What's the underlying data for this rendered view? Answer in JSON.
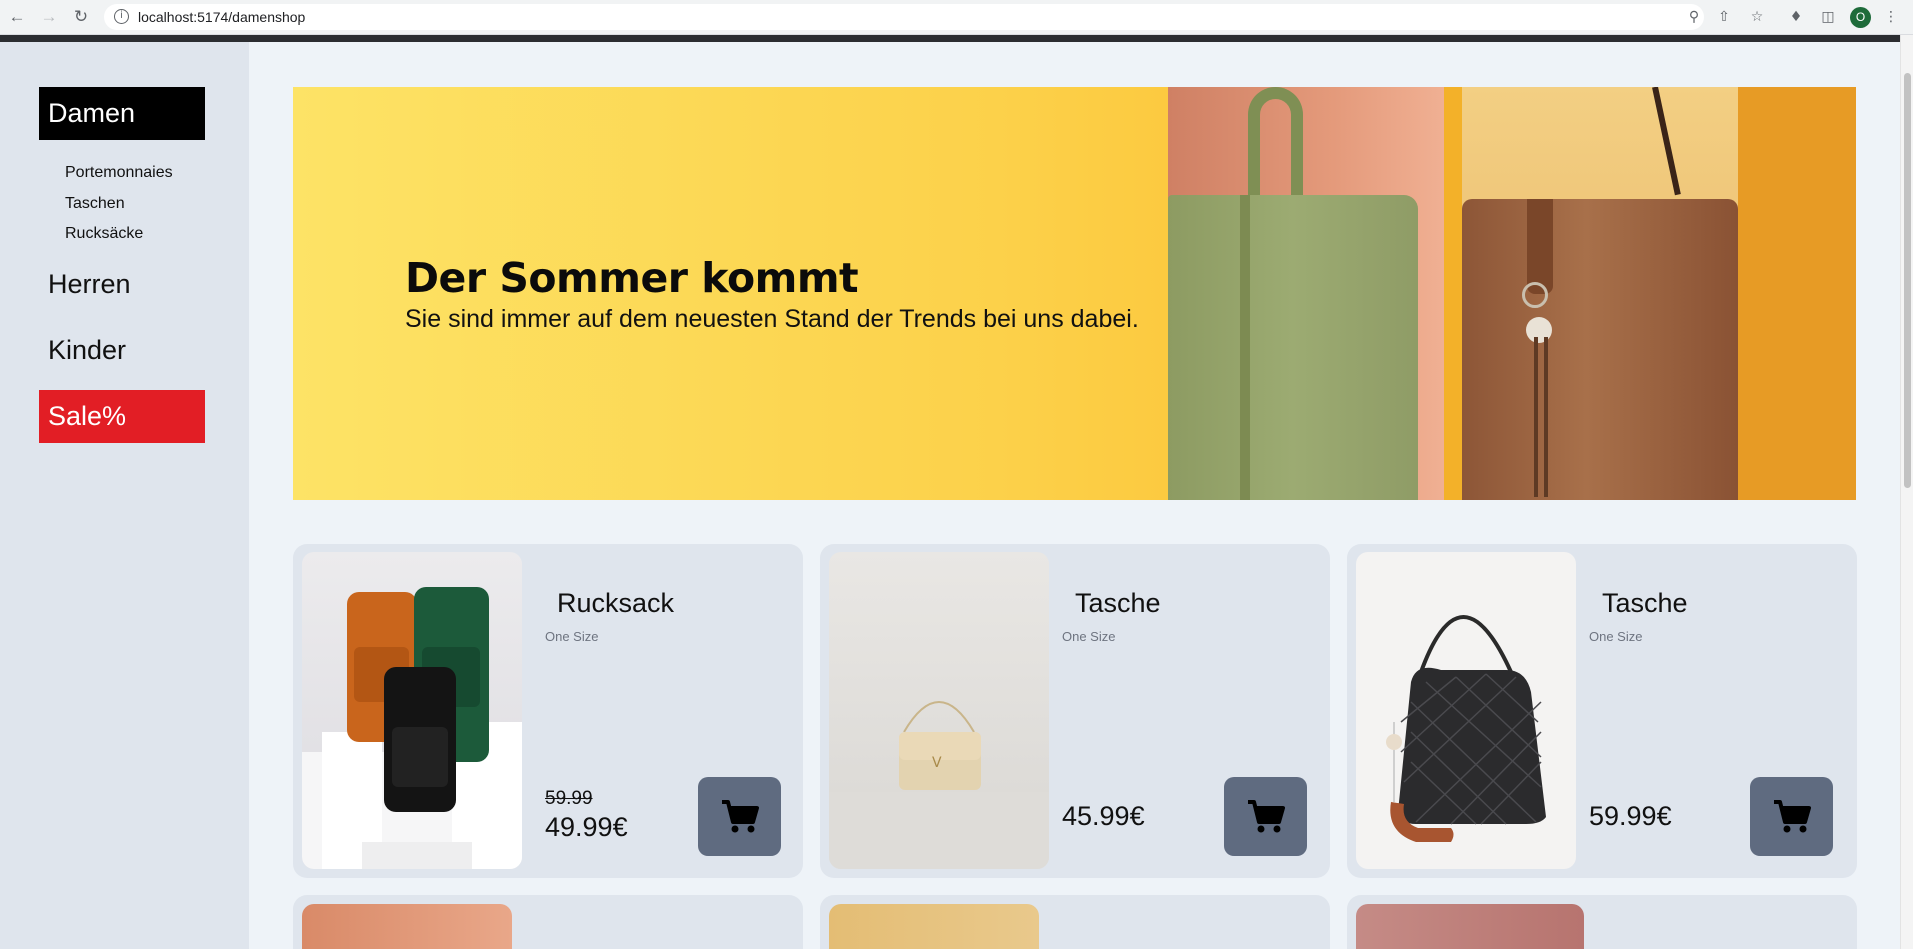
{
  "browser": {
    "url": "localhost:5174/damenshop",
    "profile_initial": "O",
    "icons": [
      "back-icon",
      "forward-icon",
      "reload-icon",
      "info-icon",
      "zoom-icon",
      "share-icon",
      "bookmark-star-icon",
      "extensions-icon",
      "side-panel-icon",
      "profile-avatar",
      "menu-dots-icon"
    ]
  },
  "sidebar": {
    "categories": [
      {
        "label": "Damen",
        "active": true
      },
      {
        "label": "Herren"
      },
      {
        "label": "Kinder"
      },
      {
        "label": "Sale%",
        "sale": true
      }
    ],
    "subcategories": [
      "Portemonnaies",
      "Taschen",
      "Rucksäcke"
    ]
  },
  "hero": {
    "title": "Der Sommer kommt",
    "subtitle": "Sie sind immer auf dem neuesten Stand der Trends bei uns dabei."
  },
  "products": [
    {
      "name": "Rucksack",
      "size": "One Size",
      "old_price": "59.99",
      "price": "49.99€"
    },
    {
      "name": "Tasche",
      "size": "One Size",
      "price": "45.99€"
    },
    {
      "name": "Tasche",
      "size": "One Size",
      "price": "59.99€"
    }
  ],
  "colors": {
    "active_category": "#000000",
    "sale": "#e21e25",
    "cart_button": "#5f6b80"
  }
}
